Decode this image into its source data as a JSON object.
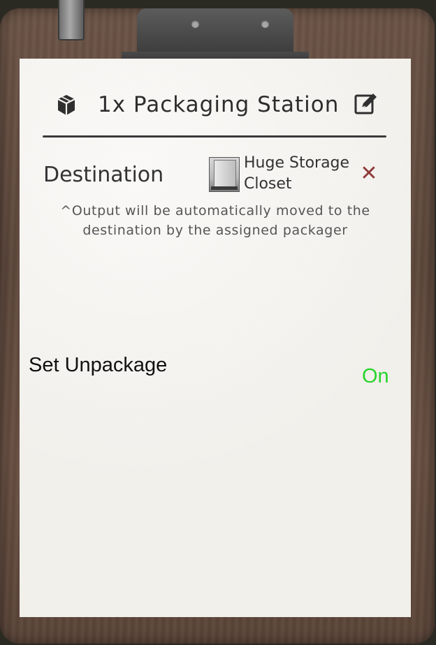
{
  "panel": {
    "title": "1x Packaging Station",
    "icons": {
      "station": "package-icon",
      "edit": "edit-icon",
      "remove": "close-icon"
    }
  },
  "destination": {
    "label": "Destination",
    "name": "Huge Storage Closet",
    "remove_glyph": "✕",
    "note": "^Output will be automatically moved to the destination by the assigned packager"
  },
  "setting": {
    "label": "Set Unpackage",
    "value": "On",
    "value_color": "#27d42b"
  },
  "colors": {
    "paper": "#f3f1ec",
    "board": "#5e483c",
    "remove": "#8e3b3b"
  }
}
